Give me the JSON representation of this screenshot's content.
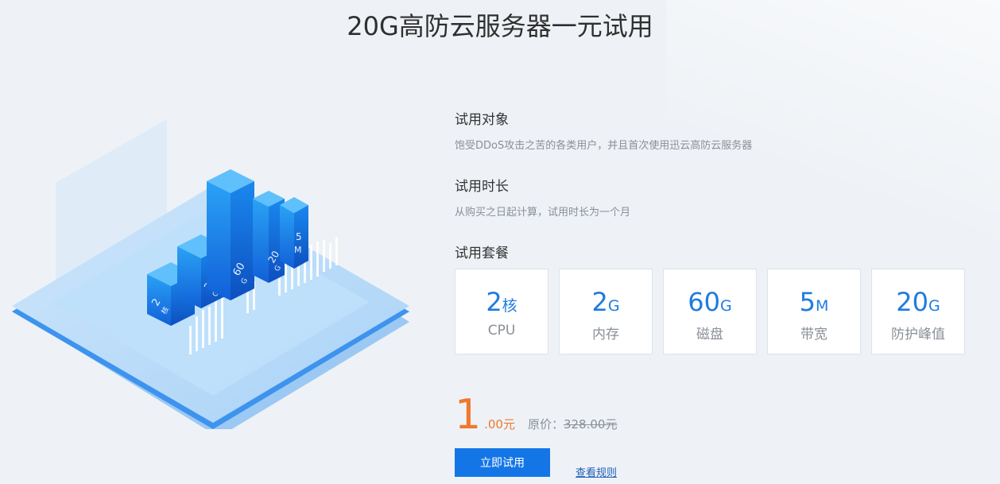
{
  "page": {
    "title": "20G高防云服务器一元试用"
  },
  "illustration": {
    "bars": [
      {
        "value": "2",
        "unit": "核"
      },
      {
        "value": "2",
        "unit": "G"
      },
      {
        "value": "60",
        "unit": "G"
      },
      {
        "value": "20",
        "unit": "G"
      },
      {
        "value": "5",
        "unit": "M"
      }
    ]
  },
  "trial_target": {
    "title": "试用对象",
    "desc": "饱受DDoS攻击之苦的各类用户，并且首次使用迅云高防云服务器"
  },
  "trial_duration": {
    "title": "试用时长",
    "desc": "从购买之日起计算，试用时长为一个月"
  },
  "trial_package": {
    "title": "试用套餐",
    "specs": [
      {
        "value": "2",
        "unit": "核",
        "label": "CPU"
      },
      {
        "value": "2",
        "unit": "G",
        "label": "内存"
      },
      {
        "value": "60",
        "unit": "G",
        "label": "磁盘"
      },
      {
        "value": "5",
        "unit": "M",
        "label": "带宽"
      },
      {
        "value": "20",
        "unit": "G",
        "label": "防护峰值"
      }
    ]
  },
  "price": {
    "integer": "1",
    "decimal": ".00元",
    "original_label": "原价：",
    "original_value": "328.00元"
  },
  "actions": {
    "trial_button": "立即试用",
    "rules_link": "查看规则"
  },
  "colors": {
    "accent": "#1476e6",
    "price": "#f0782d",
    "background": "#eef2f6"
  }
}
